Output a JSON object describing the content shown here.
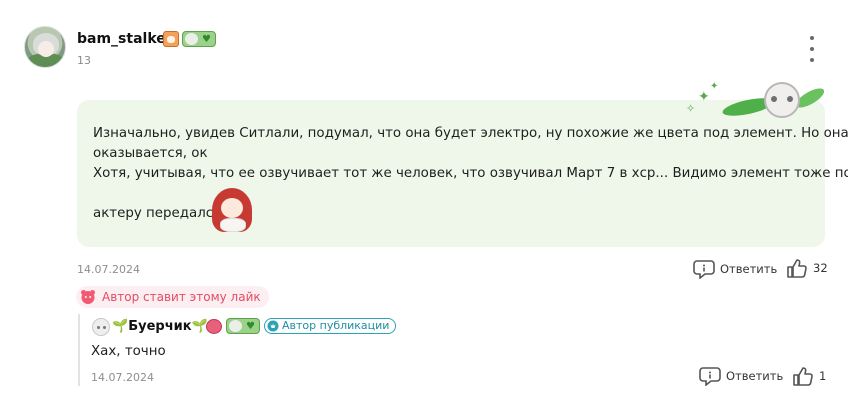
{
  "comment": {
    "username": "bam_stalker",
    "level": "13",
    "text_lines": [
      "Изначально, увидев Ситлали, подумал, что она будет электро, ну похожие же цвета под элемент. Но она крио",
      "оказывается, ок",
      "Хотя, учитывая, что ее озвучивает тот же человек, что озвучивал Март 7 в хср... Видимо элемент тоже по",
      "актеру передался"
    ],
    "date": "14.07.2024",
    "reply_label": "Ответить",
    "like_count": "32",
    "author_likes_label": "Автор ставит этому лайк"
  },
  "reply": {
    "username": "Буерчик",
    "author_badge": "Автор публикации",
    "text": "Хах, точно",
    "date": "14.07.2024",
    "reply_label": "Ответить",
    "like_count": "1"
  },
  "colors": {
    "bubble_bg": "#eef7e9",
    "author_like_accent": "#e24c64",
    "author_badge_accent": "#1f8ea0"
  },
  "icons": {
    "more": "vertical-dots-icon",
    "reply": "speech-bubble-icon",
    "like": "thumbs-up-icon",
    "author_like": "heart-face-icon",
    "author_badge": "author-badge-icon"
  }
}
